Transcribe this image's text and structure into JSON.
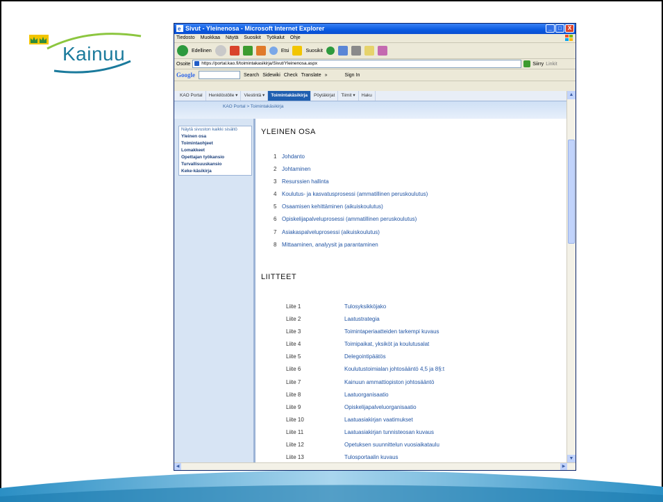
{
  "logo": {
    "text": "Kainuu"
  },
  "window": {
    "title": "Sivut - Yleinenosa - Microsoft Internet Explorer",
    "buttons": {
      "minimize": "_",
      "maximize": "□",
      "close": "X"
    }
  },
  "menubar": [
    "Tiedosto",
    "Muokkaa",
    "Näytä",
    "Suosikit",
    "Työkalut",
    "Ohje"
  ],
  "toolbar": {
    "back": "Edellinen",
    "search": "Etsi",
    "favorites": "Suosikit"
  },
  "address": {
    "label": "Osoite",
    "url": "https://portal.kao.fi/toimintakasikirja/Sivut/Yleinenosa.aspx",
    "go": "Siirry",
    "links": "Linkit"
  },
  "googlebar": {
    "logo": "Google",
    "search": "Search",
    "sidewiki": "Sidewiki",
    "check": "Check",
    "translate": "Translate",
    "more": "»",
    "signin": "Sign In"
  },
  "tabs": [
    {
      "label": "KAO Portal"
    },
    {
      "label": "Henkilöstölle ▾"
    },
    {
      "label": "Viestintä ▾"
    },
    {
      "label": "Toimintakäsikirja"
    },
    {
      "label": "Pöytäkirjat"
    },
    {
      "label": "Tiimit ▾"
    },
    {
      "label": "Haku"
    }
  ],
  "breadcrumb": "KAO Portal > Toimintakäsikirja",
  "leftnav": {
    "first": "Näytä sivuston kaikki sisältö",
    "items": [
      "Yleinen osa",
      "Toimintaohjeet",
      "Lomakkeet",
      "Opettajan työkansio",
      "Turvallisuuskansio",
      "Keke-käsikirja"
    ]
  },
  "main": {
    "title1": "YLEINEN OSA",
    "sections": [
      {
        "num": "1",
        "text": "Johdanto"
      },
      {
        "num": "2",
        "text": "Johtaminen"
      },
      {
        "num": "3",
        "text": "Resurssien hallinta"
      },
      {
        "num": "4",
        "text": "Koulutus- ja kasvatusprosessi (ammatillinen peruskoulutus)"
      },
      {
        "num": "5",
        "text": "Osaamisen kehittäminen (aikuiskoulutus)"
      },
      {
        "num": "6",
        "text": "Opiskelijapalveluprosessi (ammatillinen peruskoulutus)"
      },
      {
        "num": "7",
        "text": "Asiakaspalveluprosessi (aikuiskoulutus)"
      },
      {
        "num": "8",
        "text": "Mittaaminen, analyysit ja parantaminen"
      }
    ],
    "title2": "LIITTEET",
    "appendices": [
      {
        "label": "Liite 1",
        "text": "Tulosyksikköjako"
      },
      {
        "label": "Liite 2",
        "text": "Laatustrategia"
      },
      {
        "label": "Liite 3",
        "text": "Toimintaperiaatteiden tarkempi kuvaus"
      },
      {
        "label": "Liite 4",
        "text": "Toimipaikat, yksiköt ja koulutusalat"
      },
      {
        "label": "Liite 5",
        "text": "Delegointipäätös"
      },
      {
        "label": "Liite 6",
        "text": "Koulutustoimialan johtosääntö 4,5 ja 8§:t"
      },
      {
        "label": "Liite 7",
        "text": "Kainuun ammattiopiston johtosääntö"
      },
      {
        "label": "Liite 8",
        "text": "Laatuorganisaatio"
      },
      {
        "label": "Liite 9",
        "text": "Opiskelijapalveluorganisaatio"
      },
      {
        "label": "Liite 10",
        "text": "Laatuasiakirjan vaatimukset"
      },
      {
        "label": "Liite 11",
        "text": "Laatuasiakirjan tunnisteosan kuvaus"
      },
      {
        "label": "Liite 12",
        "text": "Opetuksen suunnittelun vuosiaikataulu"
      },
      {
        "label": "Liite 13",
        "text": "Tulosportaalin kuvaus"
      }
    ]
  },
  "scroll": {
    "up": "▲",
    "down": "▼",
    "left": "◀",
    "right": "▶"
  },
  "colors": {
    "brand": "#1a7a9c",
    "link": "#2255a4",
    "tab_active": "#1f5fb0"
  }
}
